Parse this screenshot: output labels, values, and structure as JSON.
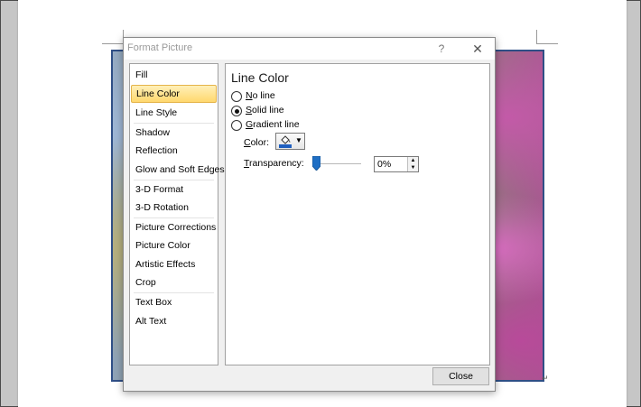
{
  "dialog": {
    "title": "Format Picture",
    "help_label": "?",
    "close_glyph": "✕",
    "close_button_label": "Close"
  },
  "nav": {
    "items": [
      {
        "label": "Fill",
        "selected": false
      },
      {
        "label": "Line Color",
        "selected": true
      },
      {
        "label": "Line Style",
        "selected": false
      },
      {
        "label": "Shadow",
        "selected": false
      },
      {
        "label": "Reflection",
        "selected": false
      },
      {
        "label": "Glow and Soft Edges",
        "selected": false
      },
      {
        "label": "3-D Format",
        "selected": false
      },
      {
        "label": "3-D Rotation",
        "selected": false
      },
      {
        "label": "Picture Corrections",
        "selected": false
      },
      {
        "label": "Picture Color",
        "selected": false
      },
      {
        "label": "Artistic Effects",
        "selected": false
      },
      {
        "label": "Crop",
        "selected": false
      },
      {
        "label": "Text Box",
        "selected": false
      },
      {
        "label": "Alt Text",
        "selected": false
      }
    ]
  },
  "panel": {
    "heading": "Line Color",
    "options": [
      {
        "access_key": "N",
        "rest": "o line",
        "checked": false
      },
      {
        "access_key": "S",
        "rest": "olid line",
        "checked": true
      },
      {
        "access_key": "G",
        "rest": "radient line",
        "checked": false
      }
    ],
    "color": {
      "access_key": "C",
      "rest": "olor:",
      "icon": "paint-bucket-icon",
      "fill_color": "#1f5fbf"
    },
    "transparency": {
      "access_key": "T",
      "rest": "ransparency:",
      "value": "0%",
      "level": 0
    }
  },
  "colors": {
    "accent_blue": "#1f6fc4",
    "selected_nav": "#ffd86e",
    "picture_border": "#2f4f86"
  }
}
